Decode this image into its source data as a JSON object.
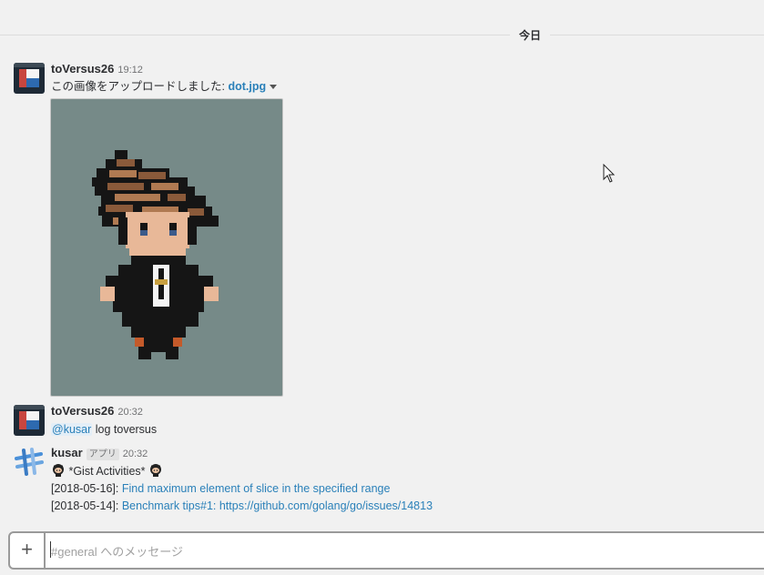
{
  "day_divider": "今日",
  "messages": [
    {
      "author": "toVersus26",
      "time": "19:12",
      "text_prefix": "この画像をアップロードしました: ",
      "file_name": "dot.jpg"
    },
    {
      "author": "toVersus26",
      "time": "20:32",
      "mention": "@kusar",
      "text": " log toversus"
    },
    {
      "author": "kusar",
      "badge": "アプリ",
      "time": "20:32",
      "title": " *Gist Activities* ",
      "entries": [
        {
          "date": "[2018-05-16]: ",
          "link": "Find maximum element of slice in the specified range"
        },
        {
          "date": "[2018-05-14]: ",
          "link": "Benchmark tips#1: ",
          "url": "https://github.com/golang/go/issues/14813"
        }
      ]
    }
  ],
  "composer": {
    "plus_label": "+",
    "placeholder": "#general へのメッセージ"
  },
  "icons": {
    "user_avatar": "avatar-icon",
    "bot_avatar": "slack-hash-icon",
    "dropdown": "caret-down-icon",
    "github": "octocat-icon",
    "mouse": "mouse-pointer-icon"
  },
  "colors": {
    "background": "#f1f1f1",
    "link": "#2a80b9",
    "image_bg": "#768a88"
  }
}
